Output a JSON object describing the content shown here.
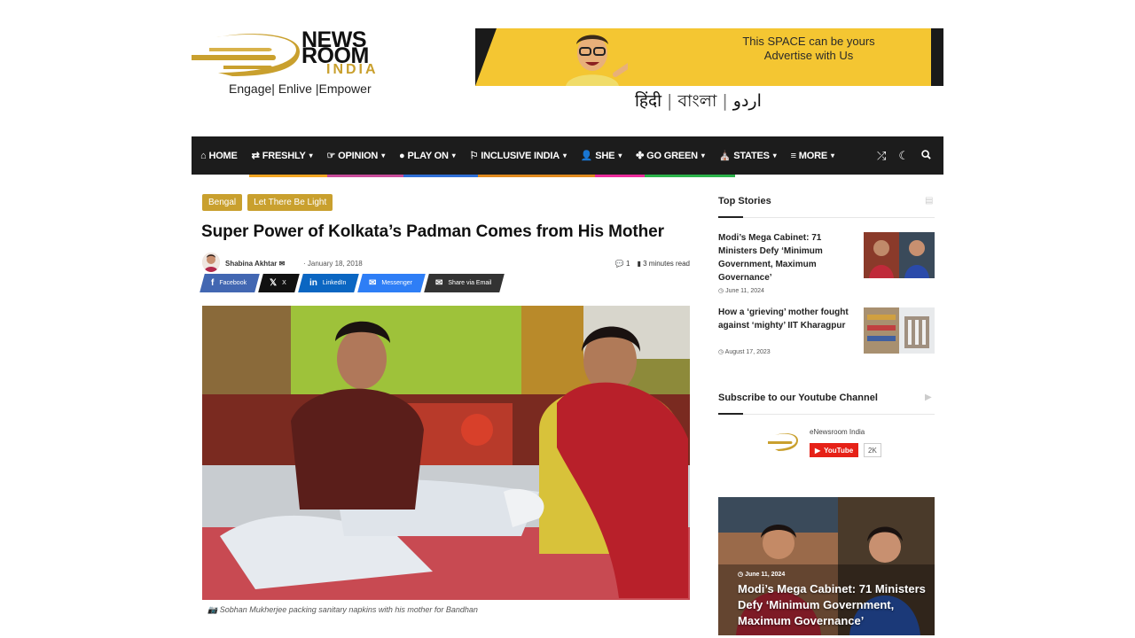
{
  "brand": {
    "logo_line1": "NEWS",
    "logo_line2": "ROOM",
    "logo_line3": "INDIA",
    "tagline": [
      "Engage",
      "Enlive",
      "Empower"
    ],
    "accent": "#c9a02e"
  },
  "ad": {
    "line1": "This SPACE can be yours",
    "line2": "Advertise with Us",
    "bg": "#f4c632"
  },
  "languages": [
    "हिंदी",
    "বাংলা",
    "اردو"
  ],
  "nav": {
    "items": [
      {
        "label": "HOME",
        "icon": "home-icon",
        "glyph": "⌂",
        "dropdown": false
      },
      {
        "label": "FRESHLY",
        "icon": "retweet-icon",
        "glyph": "⇄",
        "dropdown": true
      },
      {
        "label": "OPINION",
        "icon": "hand-point-icon",
        "glyph": "☞",
        "dropdown": true
      },
      {
        "label": "PLAY ON",
        "icon": "ball-icon",
        "glyph": "●",
        "dropdown": true
      },
      {
        "label": "INCLUSIVE INDIA",
        "icon": "flag-icon",
        "glyph": "⚐",
        "dropdown": true
      },
      {
        "label": "SHE",
        "icon": "user-icon",
        "glyph": "👤",
        "dropdown": true
      },
      {
        "label": "GO GREEN",
        "icon": "leaf-icon",
        "glyph": "✤",
        "dropdown": true
      },
      {
        "label": "STATES",
        "icon": "temple-icon",
        "glyph": "⛪",
        "dropdown": true
      },
      {
        "label": "MORE",
        "icon": "menu-icon",
        "glyph": "≡",
        "dropdown": true
      }
    ],
    "underline_colors": [
      "#f4a623",
      "#c94c9a",
      "#2f6fd6",
      "#e08a1e",
      "#ec2b9b",
      "#2bb34a"
    ],
    "tools": [
      "shuffle-icon",
      "moon-icon",
      "search-icon"
    ]
  },
  "article": {
    "tags": [
      "Bengal",
      "Let There Be Light"
    ],
    "title": "Super Power of Kolkata’s Padman Comes from His Mother",
    "author": "Shabina Akhtar",
    "date": "January 18, 2018",
    "comments": "1",
    "read_time": "3 minutes read",
    "shares": [
      {
        "label": "Facebook",
        "icon": "facebook-icon",
        "glyph": "f",
        "color": "#4267b2"
      },
      {
        "label": "X",
        "icon": "x-icon",
        "glyph": "𝕏",
        "color": "#111111"
      },
      {
        "label": "LinkedIn",
        "icon": "linkedin-icon",
        "glyph": "in",
        "color": "#0b66c2"
      },
      {
        "label": "Messenger",
        "icon": "messenger-icon",
        "glyph": "✉",
        "color": "#2e7ef6"
      },
      {
        "label": "Share via Email",
        "icon": "email-icon",
        "glyph": "✉",
        "color": "#333333"
      }
    ],
    "caption": "Sobhan Mukherjee packing sanitary napkins with his mother for Bandhan"
  },
  "sidebar": {
    "top_stories_title": "Top Stories",
    "stories": [
      {
        "title": "Modi’s Mega Cabinet: 71 Ministers Defy ‘Minimum Government, Maximum Governance’",
        "date": "June 11, 2024"
      },
      {
        "title": "How a ‘grieving’ mother fought against ‘mighty’ IIT Kharagpur",
        "date": "August 17, 2023"
      }
    ],
    "youtube_title": "Subscribe to our Youtube Channel",
    "youtube_channel": "eNewsroom India",
    "youtube_button": "YouTube",
    "youtube_count": "2K",
    "featured": {
      "date": "June 11, 2024",
      "title": "Modi’s Mega Cabinet: 71 Ministers Defy ‘Minimum Government, Maximum Governance’"
    }
  }
}
